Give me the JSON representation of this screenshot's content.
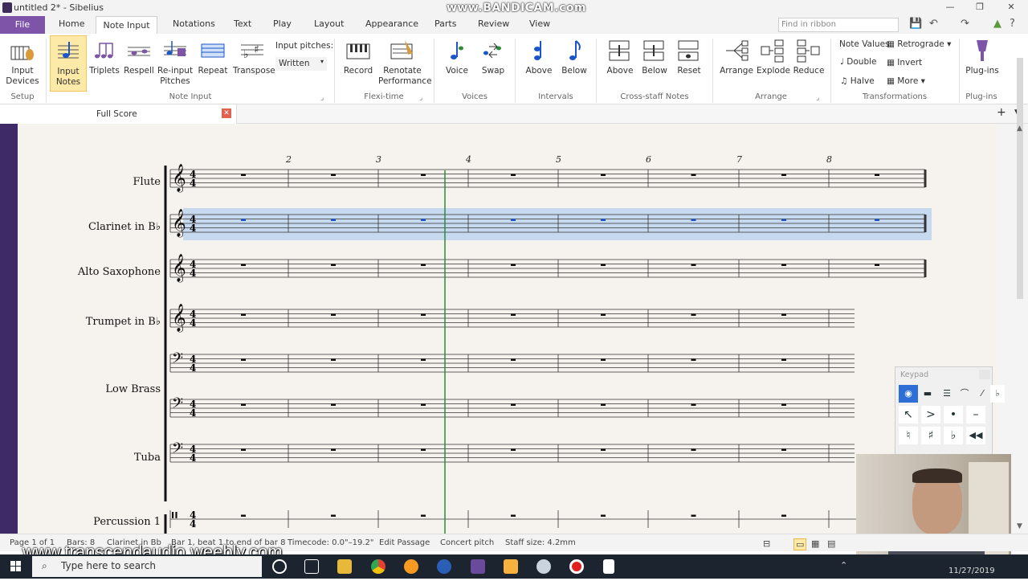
{
  "window": {
    "title": "untitled 2* - Sibelius",
    "watermark_top": "www.BANDICAM.com",
    "search_placeholder": "Find in ribbon"
  },
  "ribbon_tabs": [
    "File",
    "Home",
    "Note Input",
    "Notations",
    "Text",
    "Play",
    "Layout",
    "Appearance",
    "Parts",
    "Review",
    "View"
  ],
  "ribbon": {
    "setup": {
      "group": "Setup",
      "input_devices": "Input\nDevices"
    },
    "note_input": {
      "group": "Note Input",
      "input_notes": "Input\nNotes",
      "triplets": "Triplets",
      "respell": "Respell",
      "reinput": "Re-input\nPitches",
      "repeat": "Repeat",
      "transpose": "Transpose",
      "input_pitches_label": "Input pitches:",
      "input_pitches_value": "Written"
    },
    "flexi": {
      "group": "Flexi-time",
      "record": "Record",
      "renotate": "Renotate\nPerformance"
    },
    "voices": {
      "group": "Voices",
      "voice": "Voice",
      "swap": "Swap"
    },
    "intervals": {
      "group": "Intervals",
      "above": "Above",
      "below": "Below"
    },
    "cross": {
      "group": "Cross-staff Notes",
      "above": "Above",
      "below": "Below",
      "reset": "Reset"
    },
    "arrange": {
      "group": "Arrange",
      "arrange": "Arrange",
      "explode": "Explode",
      "reduce": "Reduce"
    },
    "transformations": {
      "group": "Transformations",
      "note_values": "Note Values",
      "double": "Double",
      "halve": "Halve",
      "retrograde": "Retrograde",
      "invert": "Invert",
      "more": "More"
    },
    "plugins": {
      "group": "Plug-ins",
      "plugins": "Plug-ins"
    }
  },
  "doc_tab": {
    "label": "Full Score"
  },
  "score": {
    "bar_numbers": [
      "2",
      "3",
      "4",
      "5",
      "6",
      "7",
      "8"
    ],
    "instruments": [
      {
        "name": "Flute",
        "clef": "treble"
      },
      {
        "name": "Clarinet in B♭",
        "clef": "treble"
      },
      {
        "name": "Alto Saxophone",
        "clef": "treble"
      },
      {
        "name": "Trumpet in B♭",
        "clef": "treble"
      },
      {
        "name": "",
        "clef": "bass"
      },
      {
        "name": "Low Brass",
        "clef": "bass"
      },
      {
        "name": "Tuba",
        "clef": "bass"
      },
      {
        "name": "Percussion 1",
        "clef": "perc"
      }
    ],
    "time_signature": "4/4",
    "selected_staff": "Clarinet in B♭"
  },
  "keypad": {
    "title": "Keypad"
  },
  "status": {
    "page": "Page 1 of 1",
    "bars": "Bars: 8",
    "instrument": "Clarinet in Bb",
    "position": "Bar 1, beat 1 to end of bar 8",
    "timecode": "Timecode: 0.0\"–19.2\"",
    "mode": "Edit Passage",
    "pitch": "Concert pitch",
    "staff_size": "Staff size: 4.2mm"
  },
  "watermark_bottom": "www.transcendaudio.weebly.com",
  "taskbar": {
    "search_placeholder": "Type here to search",
    "date": "11/27/2019"
  },
  "colors": {
    "file_tab": "#7d54a8",
    "score_bg": "#3e2a66",
    "selection": "#9fc3ee",
    "playline": "#2e8b3a"
  }
}
